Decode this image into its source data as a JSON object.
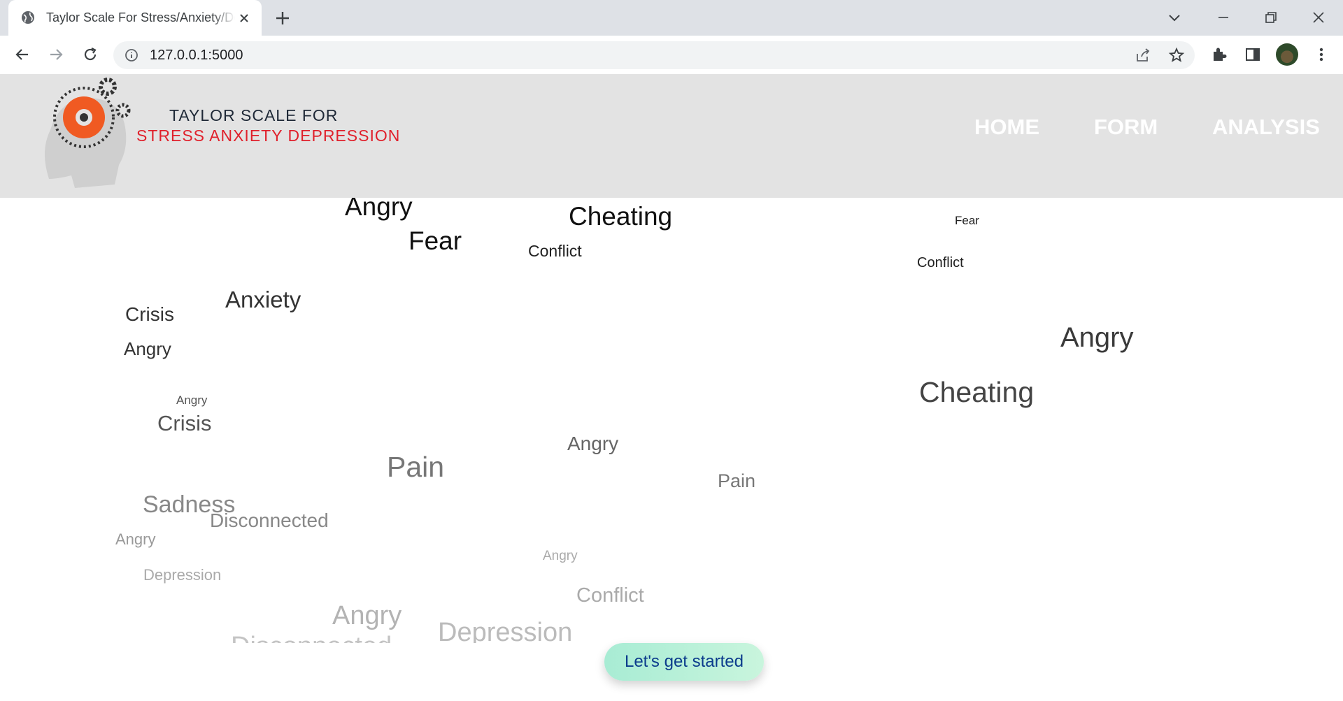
{
  "browser": {
    "tab_title": "Taylor Scale For Stress/Anxiety/Depression",
    "url": "127.0.0.1:5000"
  },
  "site": {
    "logo_line1": "TAYLOR SCALE FOR",
    "logo_line2": "STRESS ANXIETY DEPRESSION",
    "nav": [
      "HOME",
      "FORM",
      "ANALYSIS"
    ],
    "cta": "Let's get started"
  },
  "word_cloud": [
    "Angry",
    "Cheating",
    "Fear",
    "Fear",
    "Conflict",
    "Conflict",
    "Anxiety",
    "Crisis",
    "Angry",
    "Angry",
    "Cheating",
    "Angry",
    "Crisis",
    "Angry",
    "Pain",
    "Pain",
    "Sadness",
    "Disconnected",
    "Angry",
    "Angry",
    "Depression",
    "Conflict",
    "Angry",
    "Depression",
    "Disconnected"
  ]
}
